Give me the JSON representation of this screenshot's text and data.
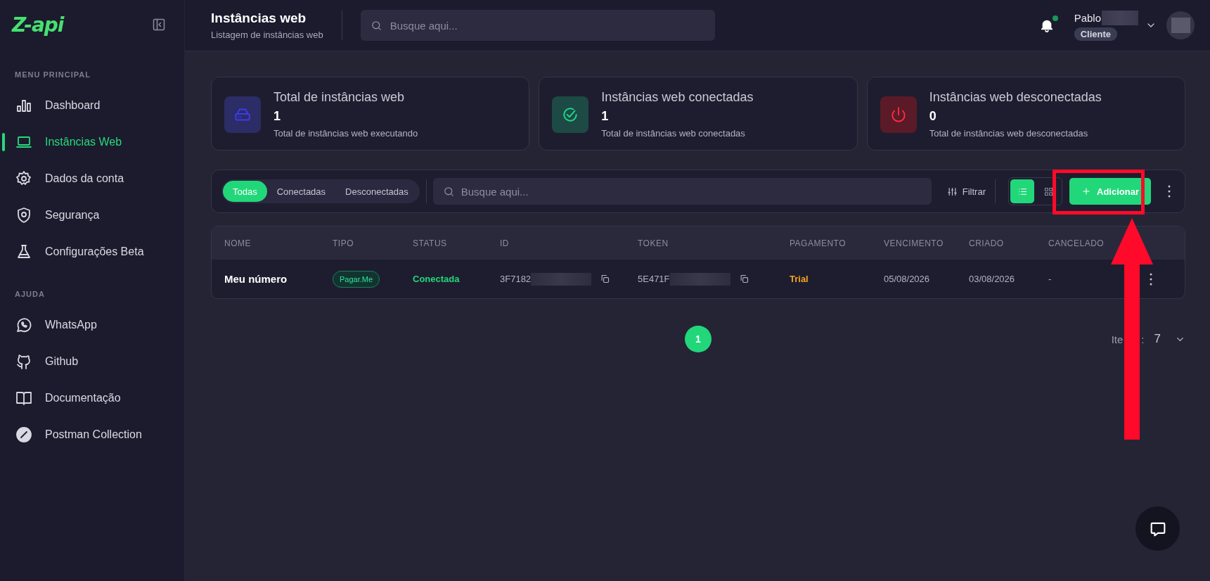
{
  "sidebar": {
    "logo": "Z-api",
    "sections": [
      {
        "title": "MENU PRINCIPAL",
        "items": [
          {
            "label": "Dashboard",
            "selected": false
          },
          {
            "label": "Instâncias Web",
            "selected": true
          },
          {
            "label": "Dados da conta",
            "selected": false
          },
          {
            "label": "Segurança",
            "selected": false
          },
          {
            "label": "Configurações Beta",
            "selected": false
          }
        ]
      },
      {
        "title": "AJUDA",
        "items": [
          {
            "label": "WhatsApp",
            "selected": false
          },
          {
            "label": "Github",
            "selected": false
          },
          {
            "label": "Documentação",
            "selected": false
          },
          {
            "label": "Postman Collection",
            "selected": false
          }
        ]
      }
    ]
  },
  "header": {
    "title": "Instâncias web",
    "subtitle": "Listagem de instâncias web",
    "search": {
      "placeholder": "Busque aqui..."
    },
    "unread_notifications": true,
    "user": {
      "name": "Pablo",
      "role": "Cliente"
    }
  },
  "stats": [
    {
      "kind": "server",
      "title": "Total de instâncias web",
      "value": "1",
      "caption": "Total de instâncias web executando"
    },
    {
      "kind": "check",
      "title": "Instâncias web conectadas",
      "value": "1",
      "caption": "Total de instâncias web conectadas"
    },
    {
      "kind": "power",
      "title": "Instâncias web desconectadas",
      "value": "0",
      "caption": "Total de instâncias web desconectadas"
    }
  ],
  "toolbar": {
    "tabs": [
      {
        "label": "Todas",
        "selected": true
      },
      {
        "label": "Conectadas",
        "selected": false
      },
      {
        "label": "Desconectadas",
        "selected": false
      }
    ],
    "search": {
      "placeholder": "Busque aqui..."
    },
    "filter": "Filtrar",
    "views": [
      {
        "kind": "list",
        "selected": true
      },
      {
        "kind": "grid",
        "selected": false
      }
    ],
    "add_button": "Adicionar"
  },
  "table": {
    "columns": [
      "NOME",
      "TIPO",
      "STATUS",
      "ID",
      "TOKEN",
      "PAGAMENTO",
      "VENCIMENTO",
      "CRIADO",
      "CANCELADO"
    ],
    "rows": [
      {
        "name": "Meu número",
        "type": "Pagar.Me",
        "status": "Conectada",
        "id": "3F7182",
        "token": "5E471F",
        "payment": "Trial",
        "due": "05/08/2026",
        "created": "03/08/2026",
        "cancelled": "-"
      }
    ]
  },
  "pagination": {
    "pages": [
      {
        "label": "1",
        "selected": true
      }
    ],
    "items_label": [
      "Ite",
      ":"
    ],
    "items_value": "7"
  }
}
